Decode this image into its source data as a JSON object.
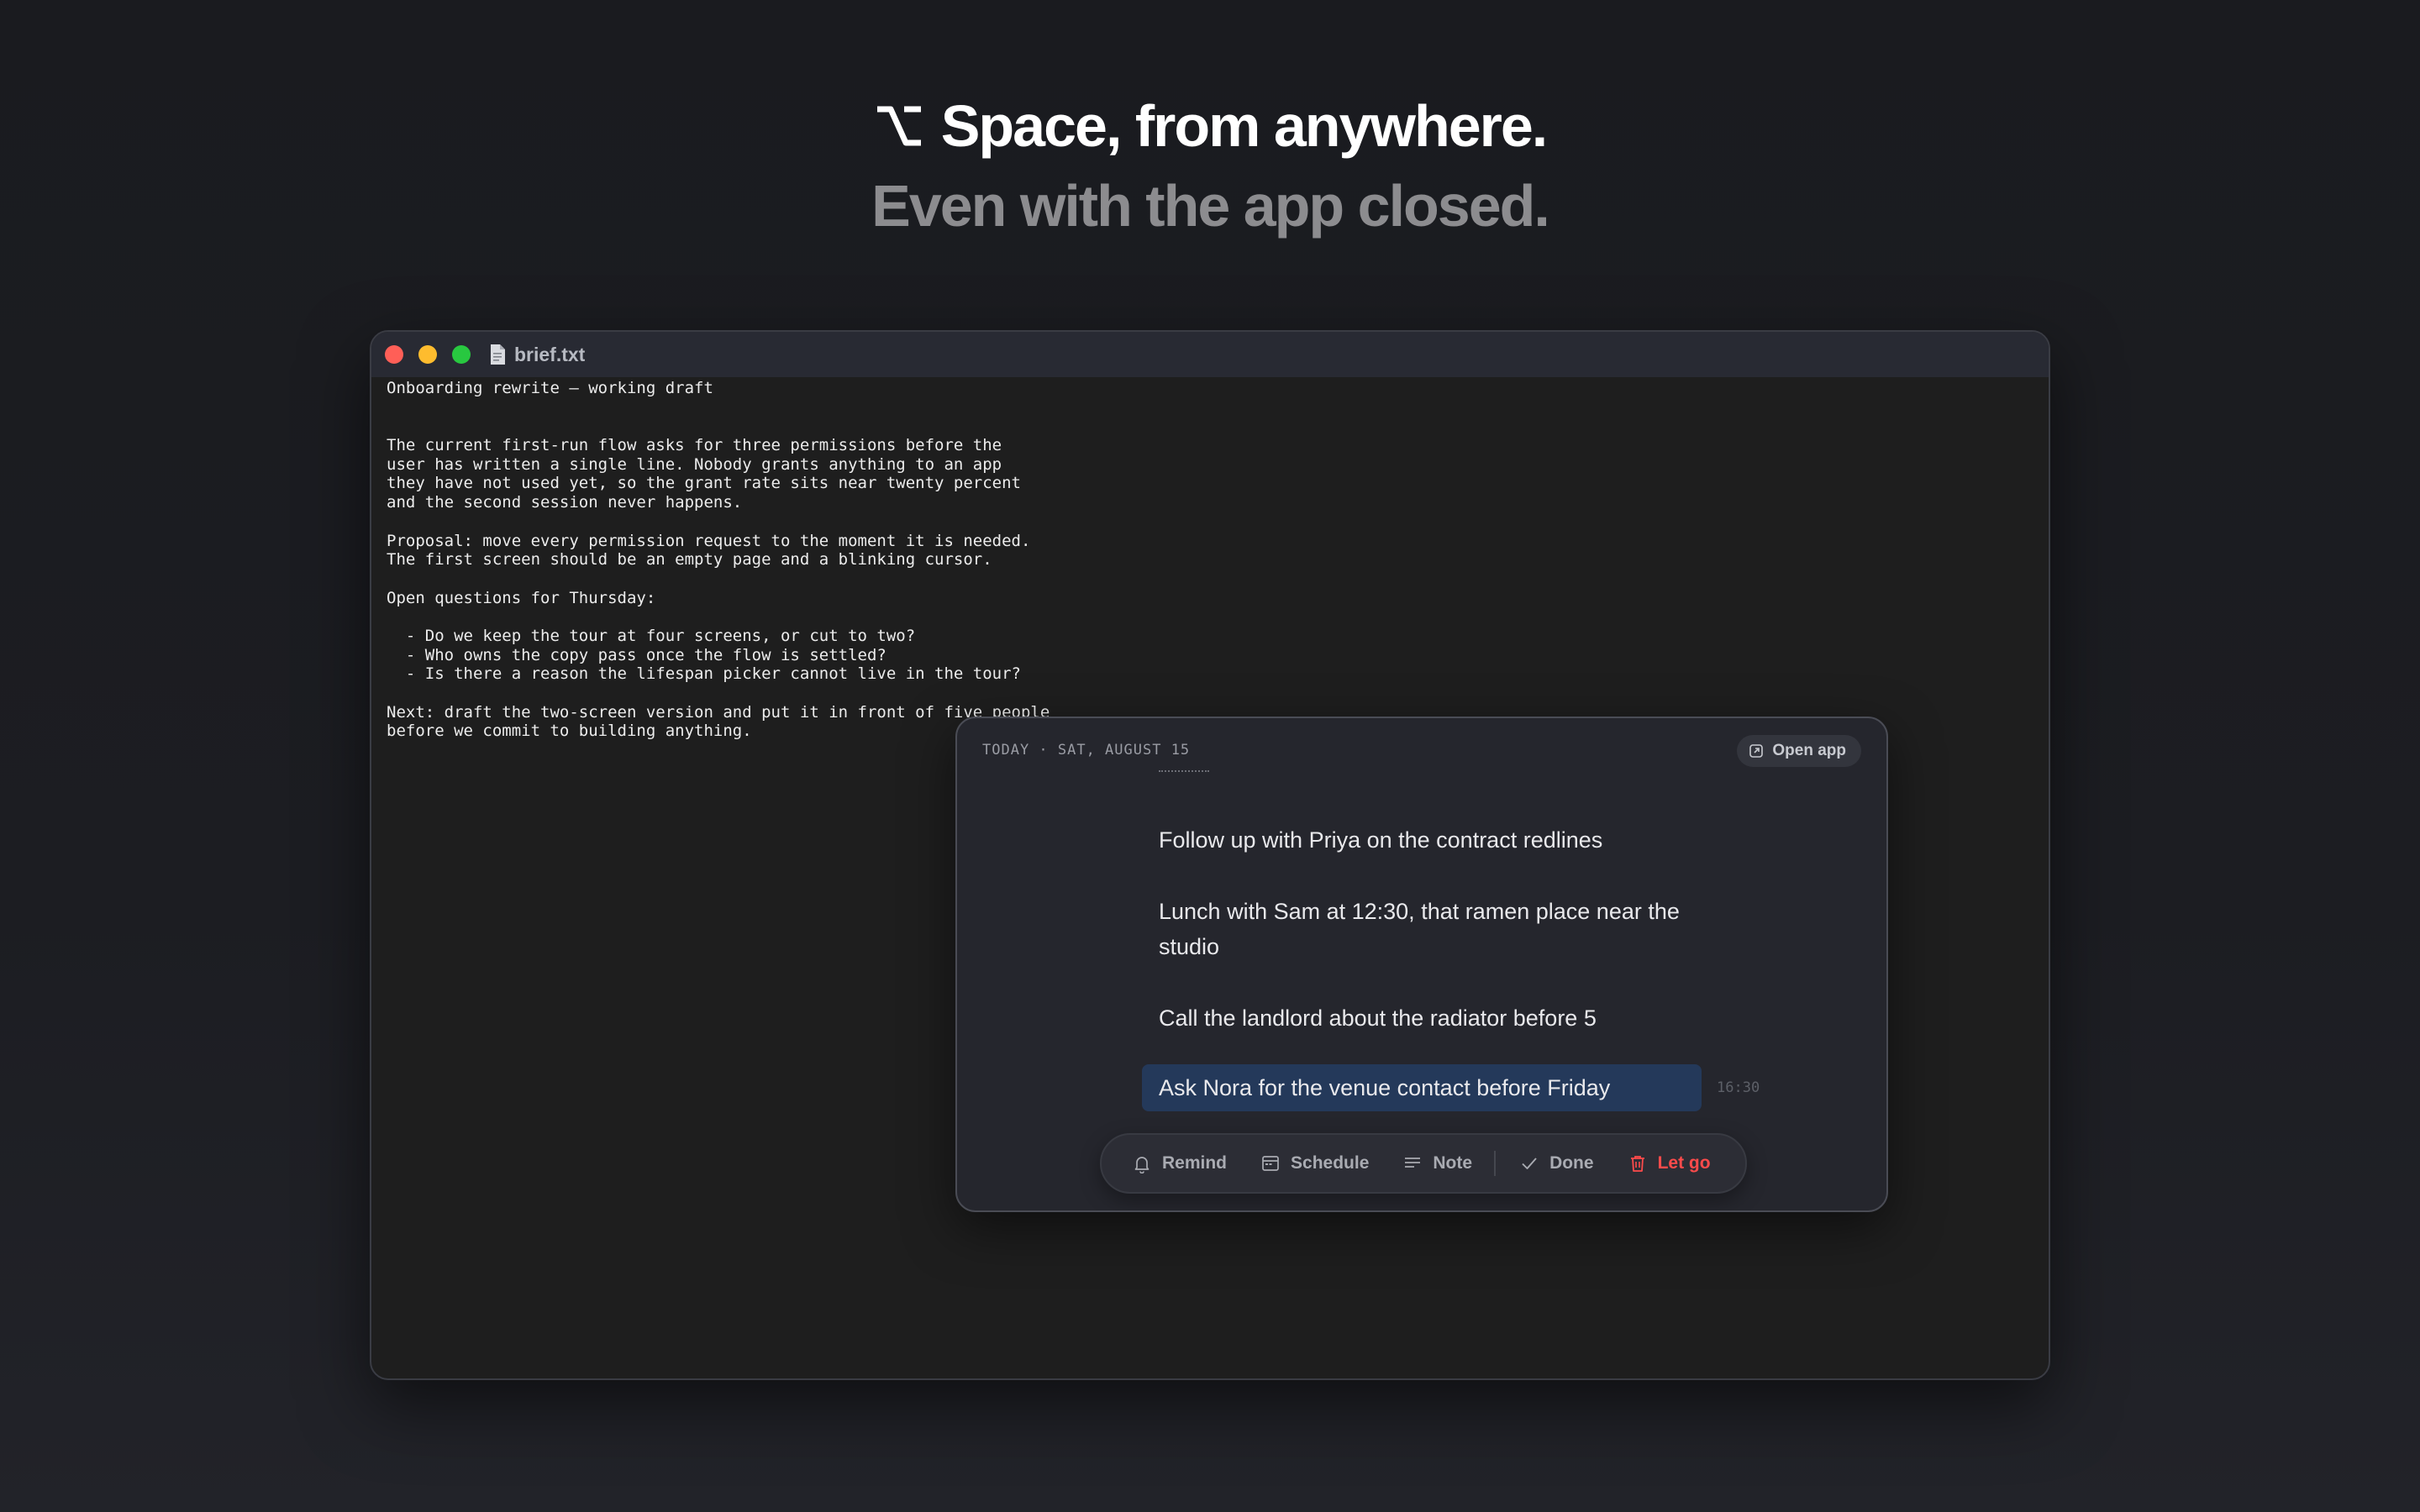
{
  "hero": {
    "shortcut_glyph": "⌥",
    "line1": "Space, from anywhere.",
    "line2": "Even with the app closed."
  },
  "window": {
    "file_name": "brief.txt",
    "traffic_lights": [
      "#ff5f57",
      "#febc2e",
      "#28c840"
    ],
    "document_lines": [
      "Onboarding rewrite — working draft",
      "",
      "",
      "The current first-run flow asks for three permissions before the",
      "user has written a single line. Nobody grants anything to an app",
      "they have not used yet, so the grant rate sits near twenty percent",
      "and the second session never happens.",
      "",
      "Proposal: move every permission request to the moment it is needed.",
      "The first screen should be an empty page and a blinking cursor.",
      "",
      "Open questions for Thursday:",
      "",
      "  - Do we keep the tour at four screens, or cut to two?",
      "  - Who owns the copy pass once the flow is settled?",
      "  - Is there a reason the lifespan picker cannot live in the tour?",
      "",
      "Next: draft the two-screen version and put it in front of five people",
      "before we commit to building anything."
    ]
  },
  "panel": {
    "date_label": "TODAY · SAT, AUGUST 15",
    "open_app_label": "Open app",
    "items": [
      "Follow up with Priya on the contract redlines",
      "Lunch with Sam at 12:30, that ramen place near the studio",
      "Call the landlord about the radiator before 5",
      "Ask Nora for the venue contact before Friday"
    ],
    "selected_timestamp": "16:30",
    "toolbar": {
      "remind": "Remind",
      "schedule": "Schedule",
      "note": "Note",
      "done": "Done",
      "let_go": "Let go"
    }
  },
  "colors": {
    "selection": "#24395a",
    "danger": "#ff4b4b"
  }
}
